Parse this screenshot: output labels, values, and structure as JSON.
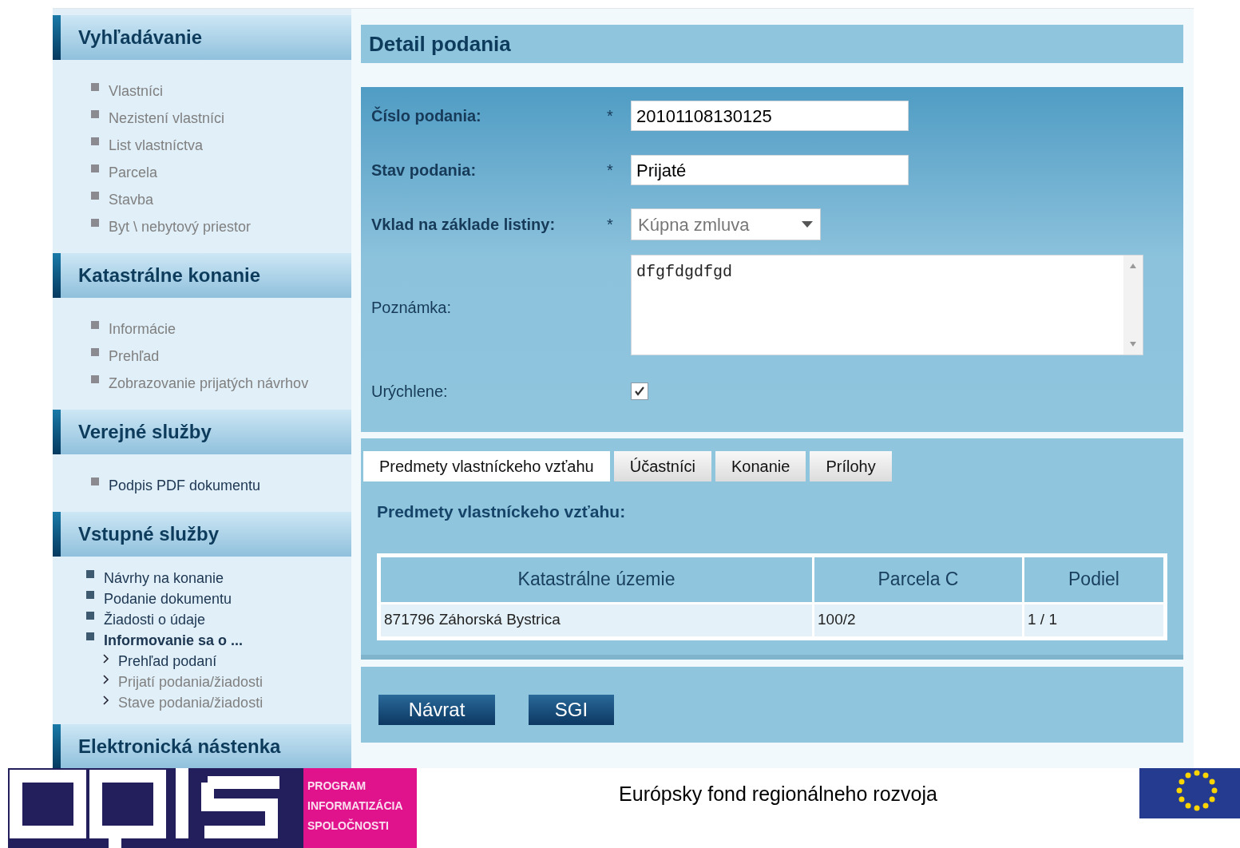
{
  "sidebar": {
    "sections": [
      {
        "title": "Vyhľadávanie",
        "kind": "list",
        "items": [
          {
            "label": "Vlastníci",
            "dimmed": true
          },
          {
            "label": "Nezistení vlastníci",
            "dimmed": true
          },
          {
            "label": "List vlastníctva",
            "dimmed": true
          },
          {
            "label": "Parcela",
            "dimmed": true
          },
          {
            "label": "Stavba",
            "dimmed": true
          },
          {
            "label": "Byt \\ nebytový priestor",
            "dimmed": true
          }
        ]
      },
      {
        "title": "Katastrálne konanie",
        "kind": "list",
        "items": [
          {
            "label": "Informácie",
            "dimmed": true
          },
          {
            "label": "Prehľad",
            "dimmed": true
          },
          {
            "label": "Zobrazovanie prijatých návrhov",
            "dimmed": true
          }
        ]
      },
      {
        "title": "Verejné služby",
        "kind": "list",
        "items": [
          {
            "label": "Podpis PDF dokumentu",
            "dimmed": false
          }
        ]
      },
      {
        "title": "Vstupné služby",
        "kind": "compact",
        "items": [
          {
            "label": "Návrhy na konanie",
            "dimmed": false
          },
          {
            "label": "Podanie dokumentu",
            "dimmed": false
          },
          {
            "label": "Žiadosti o údaje",
            "dimmed": false
          },
          {
            "label": "Informovanie sa o ...",
            "dimmed": false,
            "children": [
              {
                "label": "Prehľad podaní",
                "dimmed": false
              },
              {
                "label": "Prijatí podania/žiadosti",
                "dimmed": true
              },
              {
                "label": "Stave podania/žiadosti",
                "dimmed": true
              }
            ]
          }
        ]
      },
      {
        "title": "Elektronická nástenka"
      }
    ]
  },
  "detail": {
    "title": "Detail podania",
    "fields": [
      {
        "kind": "text",
        "label": "Číslo podania:",
        "marker": "*",
        "value": "20101108130125"
      },
      {
        "kind": "text",
        "label": "Stav podania:",
        "marker": "*",
        "value": "Prijaté"
      },
      {
        "kind": "select",
        "label": "Vklad na základe listiny:",
        "marker": "*",
        "value": "Kúpna zmluva"
      },
      {
        "kind": "textarea",
        "label": "Poznámka:",
        "value": "dfgfdgdfgd"
      },
      {
        "kind": "checkbox",
        "label": "Urýchlene:",
        "checked": true
      }
    ],
    "tabs": [
      {
        "label": "Predmety vlastníckeho vzťahu",
        "selected": true
      },
      {
        "label": "Účastníci",
        "selected": false
      },
      {
        "label": "Konanie",
        "selected": false
      },
      {
        "label": "Prílohy",
        "selected": false
      }
    ],
    "section_title": "Predmety vlastníckeho vzťahu:",
    "table": {
      "columns": [
        "Katastrálne územie",
        "Parcela C",
        "Podiel"
      ],
      "rows": [
        [
          "871796 Záhorská Bystrica",
          "100/2",
          "1 / 1"
        ]
      ]
    },
    "buttons": [
      "Návrat",
      "SGI"
    ]
  },
  "footer": {
    "program_lines": [
      "PROGRAM",
      "INFORMATIZÁCIA",
      "SPOLOČNOSTI"
    ],
    "fund": "Európsky fond regionálneho rozvoja"
  }
}
